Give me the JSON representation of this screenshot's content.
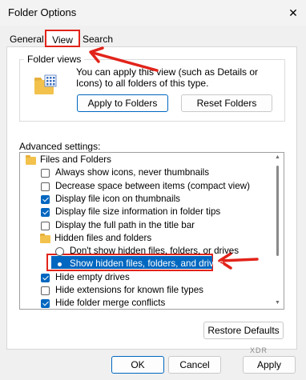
{
  "window": {
    "title": "Folder Options",
    "close_glyph": "✕"
  },
  "tabs": [
    {
      "label": "General"
    },
    {
      "label": "View"
    },
    {
      "label": "Search"
    }
  ],
  "folder_views": {
    "legend": "Folder views",
    "description": "You can apply this view (such as Details or Icons) to all folders of this type.",
    "apply_button": "Apply to Folders",
    "reset_button": "Reset Folders"
  },
  "advanced": {
    "label": "Advanced settings:",
    "items": [
      {
        "type": "folder",
        "label": "Files and Folders"
      },
      {
        "type": "checkbox",
        "checked": false,
        "label": "Always show icons, never thumbnails"
      },
      {
        "type": "checkbox",
        "checked": false,
        "label": "Decrease space between items (compact view)"
      },
      {
        "type": "checkbox",
        "checked": true,
        "label": "Display file icon on thumbnails"
      },
      {
        "type": "checkbox",
        "checked": true,
        "label": "Display file size information in folder tips"
      },
      {
        "type": "checkbox",
        "checked": false,
        "label": "Display the full path in the title bar"
      },
      {
        "type": "folder",
        "label": "Hidden files and folders"
      },
      {
        "type": "radio",
        "checked": false,
        "label": "Don't show hidden files, folders, or drives"
      },
      {
        "type": "radio",
        "checked": true,
        "label": "Show hidden files, folders, and drives"
      },
      {
        "type": "checkbox",
        "checked": true,
        "label": "Hide empty drives"
      },
      {
        "type": "checkbox",
        "checked": false,
        "label": "Hide extensions for known file types"
      },
      {
        "type": "checkbox",
        "checked": true,
        "label": "Hide folder merge conflicts"
      }
    ],
    "restore_button": "Restore Defaults"
  },
  "footer": {
    "ok": "OK",
    "cancel": "Cancel",
    "apply": "Apply"
  },
  "watermark": "XDR",
  "colors": {
    "accent": "#0067c0",
    "annotation_red": "#e2231a"
  }
}
